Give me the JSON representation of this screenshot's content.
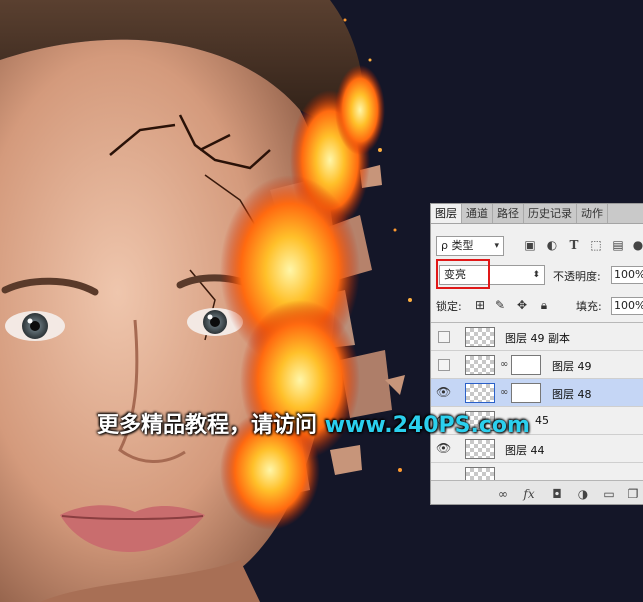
{
  "panel": {
    "tabs": [
      "图层",
      "通道",
      "路径",
      "历史记录",
      "动作"
    ],
    "filter": {
      "label": "ρ 类型"
    },
    "blend_mode": "变亮",
    "opacity_label": "不透明度:",
    "opacity_value": "100%",
    "lock_label": "锁定:",
    "fill_label": "填充:",
    "fill_value": "100%",
    "layers": [
      {
        "name": "图层 49 副本",
        "visible": false,
        "selected": false,
        "has_mask": false
      },
      {
        "name": "图层 49",
        "visible": false,
        "selected": false,
        "has_mask": true
      },
      {
        "name": "图层 48",
        "visible": true,
        "selected": true,
        "has_mask": true
      },
      {
        "name": "45",
        "visible": true,
        "selected": false,
        "has_mask": false
      },
      {
        "name": "图层 44",
        "visible": true,
        "selected": false,
        "has_mask": false
      }
    ],
    "footer_icons": [
      "link-icon",
      "fx-icon",
      "add-mask-icon",
      "adjustment-icon",
      "group-folder-icon",
      "new-layer-icon"
    ]
  },
  "watermark": {
    "chinese": "更多精品教程，请访问",
    "url": "www.240PS.com"
  },
  "colors": {
    "background": "#141628",
    "selection": "#c5d6f5",
    "highlight_box": "#e01818",
    "watermark_url": "#2bd0ee"
  }
}
